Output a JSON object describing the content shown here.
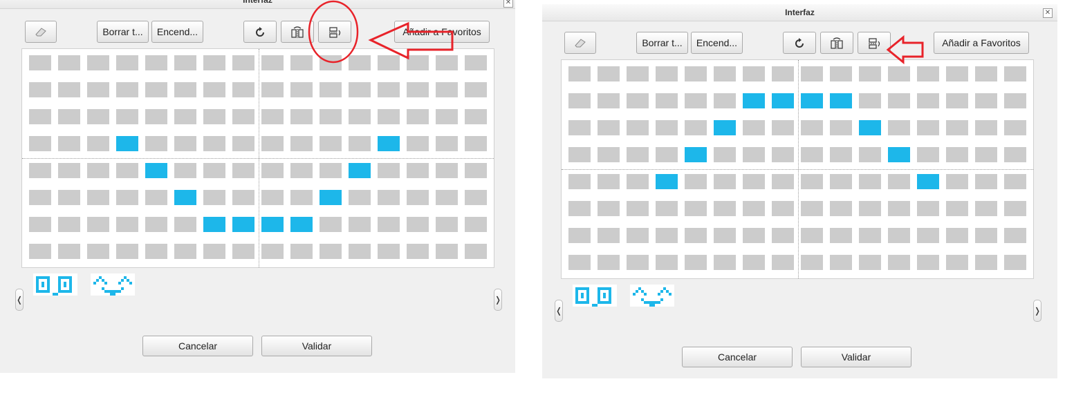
{
  "window": {
    "title": "Interfaz",
    "close_symbol": "✕"
  },
  "toolbar": {
    "borrar_label": "Borrar t...",
    "encender_label": "Encend...",
    "favoritos_label": "Añadir a Favoritos"
  },
  "footer": {
    "cancel_label": "Cancelar",
    "validate_label": "Validar"
  },
  "nav": {
    "prev_symbol": "❬",
    "next_symbol": "❭"
  },
  "colors": {
    "lit": "#1db7ea",
    "off": "#cccccc",
    "annotation": "#e8232a"
  },
  "icons": [
    "eraser-icon",
    "rotate-icon",
    "flip-horizontal-icon",
    "flip-vertical-icon"
  ],
  "screens": [
    {
      "lit_cells": [
        [
          3,
          3
        ],
        [
          3,
          12
        ],
        [
          4,
          4
        ],
        [
          4,
          11
        ],
        [
          5,
          5
        ],
        [
          5,
          10
        ],
        [
          6,
          6
        ],
        [
          6,
          7
        ],
        [
          6,
          8
        ],
        [
          6,
          9
        ]
      ],
      "annotation": "circle-and-arrow"
    },
    {
      "lit_cells": [
        [
          1,
          6
        ],
        [
          1,
          7
        ],
        [
          1,
          8
        ],
        [
          1,
          9
        ],
        [
          2,
          5
        ],
        [
          2,
          10
        ],
        [
          3,
          4
        ],
        [
          3,
          11
        ],
        [
          4,
          3
        ],
        [
          4,
          12
        ]
      ],
      "annotation": "arrow"
    }
  ]
}
